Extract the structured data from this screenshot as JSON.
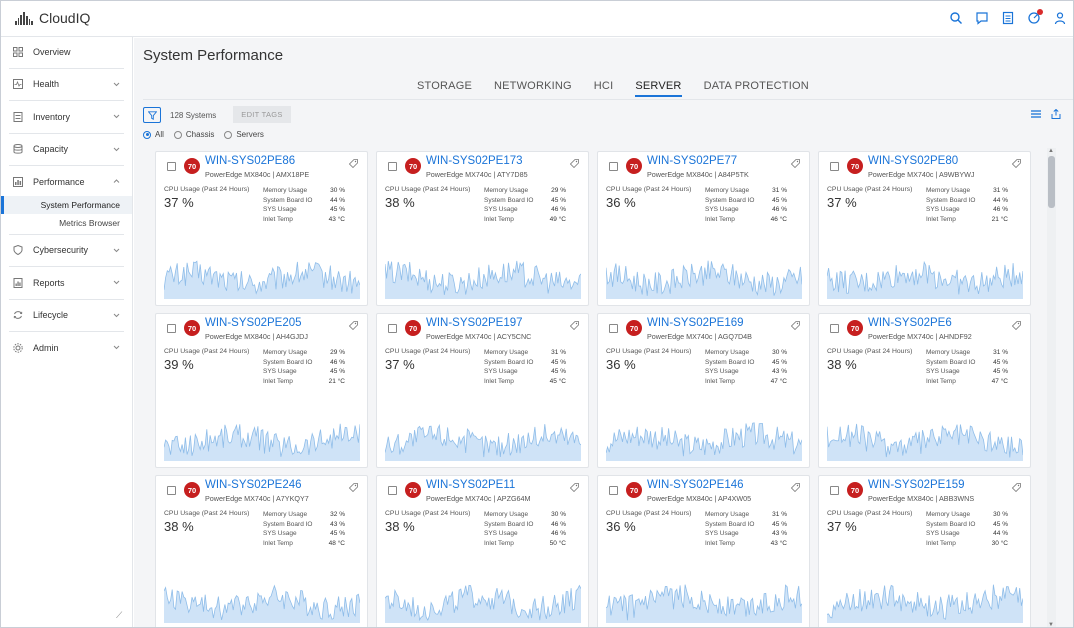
{
  "app": {
    "name": "CloudIQ"
  },
  "topbar_icons": [
    "search-icon",
    "chat-icon",
    "list-icon",
    "alerts-icon",
    "user-icon"
  ],
  "sidebar": {
    "items": [
      {
        "label": "Overview",
        "icon": "grid-icon",
        "expandable": false
      },
      {
        "label": "Health",
        "icon": "health-icon",
        "expandable": true
      },
      {
        "label": "Inventory",
        "icon": "inventory-icon",
        "expandable": true
      },
      {
        "label": "Capacity",
        "icon": "capacity-icon",
        "expandable": true
      },
      {
        "label": "Performance",
        "icon": "performance-icon",
        "expandable": true,
        "expanded": true,
        "children": [
          {
            "label": "System Performance",
            "active": true
          },
          {
            "label": "Metrics Browser",
            "active": false
          }
        ]
      },
      {
        "label": "Cybersecurity",
        "icon": "shield-icon",
        "expandable": true
      },
      {
        "label": "Reports",
        "icon": "reports-icon",
        "expandable": true
      },
      {
        "label": "Lifecycle",
        "icon": "lifecycle-icon",
        "expandable": true
      },
      {
        "label": "Admin",
        "icon": "admin-icon",
        "expandable": true
      }
    ]
  },
  "page": {
    "title": "System Performance",
    "tabs": [
      "STORAGE",
      "NETWORKING",
      "HCI",
      "SERVER",
      "DATA PROTECTION"
    ],
    "active_tab": "SERVER",
    "system_count": "128 Systems",
    "edit_tags_label": "EDIT TAGS",
    "radios": [
      {
        "label": "All",
        "checked": true
      },
      {
        "label": "Chassis",
        "checked": false
      },
      {
        "label": "Servers",
        "checked": false
      }
    ]
  },
  "card_labels": {
    "cpu": "CPU Usage (Past 24 Hours)",
    "memory": "Memory Usage",
    "board_io": "System Board IO",
    "sys": "SYS Usage",
    "inlet": "Inlet Temp"
  },
  "cards": [
    {
      "score": "70",
      "name": "WIN-SYS02PE86",
      "model": "PowerEdge MX840c | AMX18PE",
      "cpu": "37 %",
      "memory": "30 %",
      "board_io": "44 %",
      "sys": "45 %",
      "inlet": "43 °C"
    },
    {
      "score": "70",
      "name": "WIN-SYS02PE173",
      "model": "PowerEdge MX740c | ATY7D85",
      "cpu": "38 %",
      "memory": "29 %",
      "board_io": "45 %",
      "sys": "46 %",
      "inlet": "49 °C"
    },
    {
      "score": "70",
      "name": "WIN-SYS02PE77",
      "model": "PowerEdge MX840c | A84P5TK",
      "cpu": "36 %",
      "memory": "31 %",
      "board_io": "45 %",
      "sys": "46 %",
      "inlet": "46 °C"
    },
    {
      "score": "70",
      "name": "WIN-SYS02PE80",
      "model": "PowerEdge MX740c | A9WBYWJ",
      "cpu": "37 %",
      "memory": "31 %",
      "board_io": "44 %",
      "sys": "46 %",
      "inlet": "21 °C"
    },
    {
      "score": "70",
      "name": "WIN-SYS02PE205",
      "model": "PowerEdge MX840c | AH4GJDJ",
      "cpu": "39 %",
      "memory": "29 %",
      "board_io": "46 %",
      "sys": "45 %",
      "inlet": "21 °C"
    },
    {
      "score": "70",
      "name": "WIN-SYS02PE197",
      "model": "PowerEdge MX740c | ACY5CNC",
      "cpu": "37 %",
      "memory": "31 %",
      "board_io": "45 %",
      "sys": "45 %",
      "inlet": "45 °C"
    },
    {
      "score": "70",
      "name": "WIN-SYS02PE169",
      "model": "PowerEdge MX740c | AGQ7D4B",
      "cpu": "36 %",
      "memory": "30 %",
      "board_io": "45 %",
      "sys": "43 %",
      "inlet": "47 °C"
    },
    {
      "score": "70",
      "name": "WIN-SYS02PE6",
      "model": "PowerEdge MX740c | AHNDF92",
      "cpu": "38 %",
      "memory": "31 %",
      "board_io": "45 %",
      "sys": "45 %",
      "inlet": "47 °C"
    },
    {
      "score": "70",
      "name": "WIN-SYS02PE246",
      "model": "PowerEdge MX740c | A7YKQY7",
      "cpu": "38 %",
      "memory": "32 %",
      "board_io": "43 %",
      "sys": "45 %",
      "inlet": "48 °C"
    },
    {
      "score": "70",
      "name": "WIN-SYS02PE11",
      "model": "PowerEdge MX740c | APZG64M",
      "cpu": "38 %",
      "memory": "30 %",
      "board_io": "46 %",
      "sys": "46 %",
      "inlet": "50 °C"
    },
    {
      "score": "70",
      "name": "WIN-SYS02PE146",
      "model": "PowerEdge MX840c | AP4XW05",
      "cpu": "36 %",
      "memory": "31 %",
      "board_io": "45 %",
      "sys": "43 %",
      "inlet": "43 °C"
    },
    {
      "score": "70",
      "name": "WIN-SYS02PE159",
      "model": "PowerEdge MX840c | ABB3WNS",
      "cpu": "37 %",
      "memory": "30 %",
      "board_io": "45 %",
      "sys": "44 %",
      "inlet": "30 °C"
    }
  ],
  "colors": {
    "accent": "#1a74d8",
    "badge": "#c61f1f",
    "sparkline_fill": "#cfe3f7",
    "sparkline_stroke": "#8fbde9"
  }
}
